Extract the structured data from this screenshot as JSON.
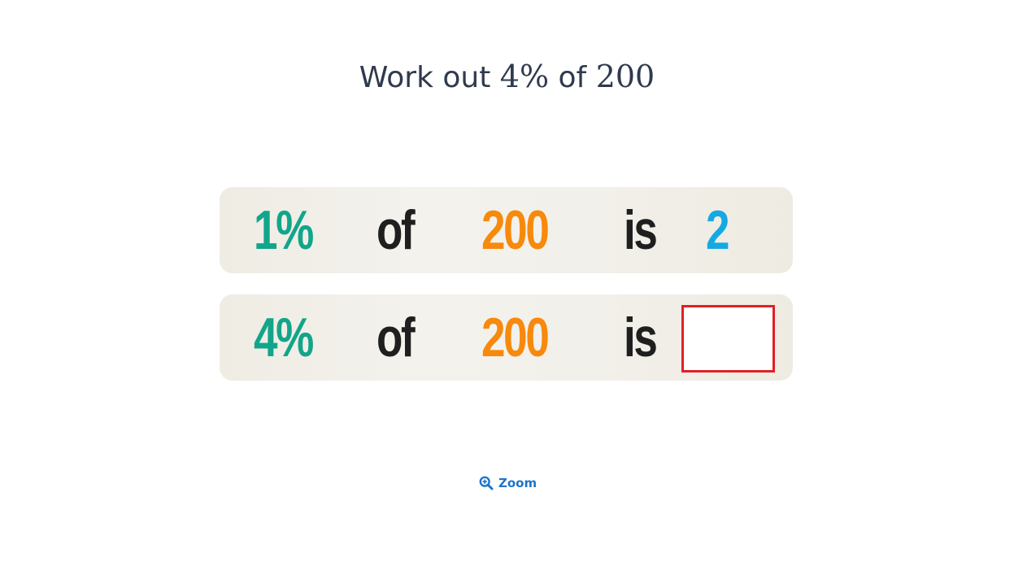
{
  "question": {
    "prefix": "Work out",
    "percent": "4%",
    "middle": "of",
    "number": "200"
  },
  "rows": [
    {
      "percent": "1%",
      "of": "of",
      "number": "200",
      "is": "is",
      "answer": "2"
    },
    {
      "percent": "4%",
      "of": "of",
      "number": "200",
      "is": "is",
      "answer": ""
    }
  ],
  "zoom": {
    "label": "Zoom",
    "icon": "zoom-in-icon"
  },
  "colors": {
    "question_text": "#2f3a4d",
    "percent": "#12a58a",
    "word": "#1f1f1f",
    "number": "#f7890c",
    "answer": "#16a9e1",
    "answer_box_border": "#e31f26",
    "zoom": "#1f74c9",
    "row_background": "#f2f0ea"
  }
}
